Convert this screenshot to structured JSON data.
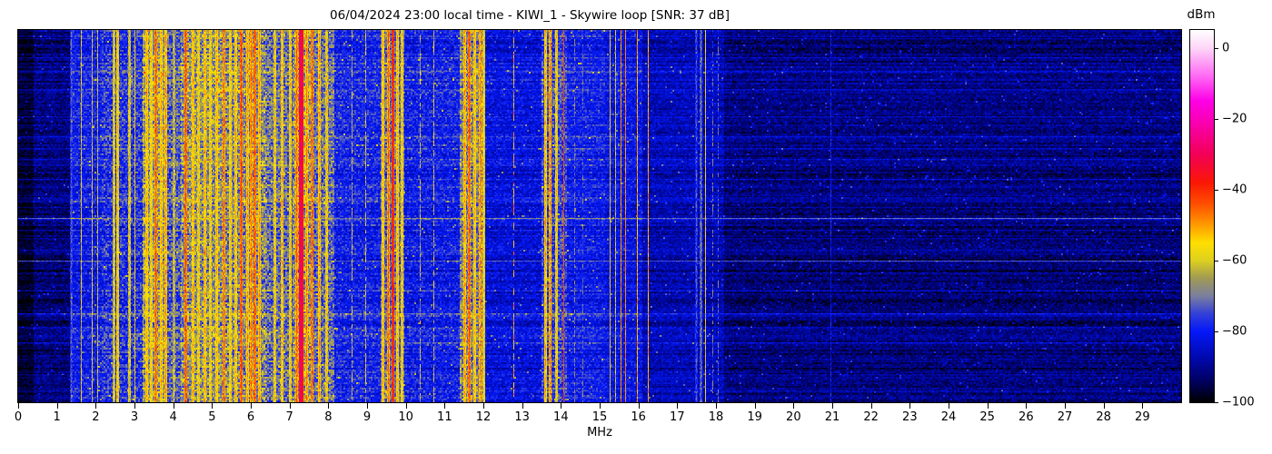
{
  "title": "06/04/2024 23:00 local time - KIWI_1 - Skywire loop [SNR: 37 dB]",
  "chart_data": {
    "type": "heatmap",
    "subtype": "hf-spectrogram-waterfall",
    "xlabel": "MHz",
    "x_range": [
      0,
      30
    ],
    "x_ticks": [
      0,
      1,
      2,
      3,
      4,
      5,
      6,
      7,
      8,
      9,
      10,
      11,
      12,
      13,
      14,
      15,
      16,
      17,
      18,
      19,
      20,
      21,
      22,
      23,
      24,
      25,
      26,
      27,
      28,
      29
    ],
    "y_ticks": [],
    "colorbar": {
      "label": "dBm",
      "vmax": 5,
      "vmin": -100,
      "ticks": [
        0,
        -20,
        -40,
        -60,
        -80,
        -100
      ],
      "tick_labels": [
        "0",
        "−20",
        "−40",
        "−60",
        "−80",
        "−100"
      ],
      "stops": [
        {
          "v": 5,
          "c": "#ffffff"
        },
        {
          "v": 0,
          "c": "#fed7f8"
        },
        {
          "v": -8,
          "c": "#ff6af4"
        },
        {
          "v": -15,
          "c": "#fe00e6"
        },
        {
          "v": -22,
          "c": "#f800a8"
        },
        {
          "v": -30,
          "c": "#f30057"
        },
        {
          "v": -38,
          "c": "#fa1705"
        },
        {
          "v": -44,
          "c": "#ff4e00"
        },
        {
          "v": -50,
          "c": "#ff9b00"
        },
        {
          "v": -55,
          "c": "#ffdf00"
        },
        {
          "v": -60,
          "c": "#ddd01e"
        },
        {
          "v": -65,
          "c": "#a09a55"
        },
        {
          "v": -70,
          "c": "#7b7f9e"
        },
        {
          "v": -75,
          "c": "#3340d8"
        },
        {
          "v": -80,
          "c": "#0418f8"
        },
        {
          "v": -88,
          "c": "#0008a8"
        },
        {
          "v": -94,
          "c": "#000060"
        },
        {
          "v": -100,
          "c": "#000000"
        }
      ]
    },
    "bands": [
      [
        0.0,
        0.4,
        -97,
        3
      ],
      [
        0.4,
        1.35,
        -92,
        5
      ],
      [
        1.35,
        2.15,
        -80,
        7
      ],
      [
        2.15,
        3.2,
        -77,
        9
      ],
      [
        3.2,
        3.85,
        -66,
        11
      ],
      [
        3.85,
        4.2,
        -73,
        10
      ],
      [
        4.2,
        5.3,
        -67,
        11
      ],
      [
        5.3,
        6.4,
        -68,
        11
      ],
      [
        6.4,
        7.1,
        -71,
        10
      ],
      [
        7.1,
        7.6,
        -66,
        11
      ],
      [
        7.6,
        8.15,
        -71,
        10
      ],
      [
        8.15,
        9.35,
        -79,
        7
      ],
      [
        9.35,
        9.95,
        -71,
        9
      ],
      [
        9.95,
        11.4,
        -80,
        7
      ],
      [
        11.4,
        12.05,
        -69,
        10
      ],
      [
        12.05,
        13.5,
        -83,
        6
      ],
      [
        13.5,
        14.15,
        -75,
        8
      ],
      [
        14.15,
        15.15,
        -80,
        6
      ],
      [
        15.15,
        16.1,
        -82,
        6
      ],
      [
        16.1,
        18.2,
        -87,
        5
      ],
      [
        18.2,
        30.0,
        -92,
        5
      ]
    ],
    "carriers": [
      [
        1.35,
        -74,
        2,
        0.3
      ],
      [
        1.61,
        -60,
        1,
        0.4
      ],
      [
        1.91,
        -61,
        1,
        0.4
      ],
      [
        2.05,
        -63,
        1,
        0.4
      ],
      [
        2.45,
        -58,
        2,
        0.35
      ],
      [
        2.55,
        -54,
        3,
        0.3
      ],
      [
        2.85,
        -58,
        2,
        0.4
      ],
      [
        3.01,
        -58,
        1,
        0.4
      ],
      [
        3.3,
        -52,
        2,
        0.3
      ],
      [
        3.42,
        -55,
        2,
        0.3
      ],
      [
        3.55,
        -45,
        3,
        0.3
      ],
      [
        3.68,
        -52,
        2,
        0.3
      ],
      [
        3.8,
        -50,
        2,
        0.3
      ],
      [
        4.0,
        -62,
        2,
        0.4
      ],
      [
        4.32,
        -44,
        3,
        0.3
      ],
      [
        4.5,
        -52,
        2,
        0.35
      ],
      [
        4.65,
        -55,
        2,
        0.35
      ],
      [
        4.8,
        -52,
        2,
        0.35
      ],
      [
        4.95,
        -55,
        2,
        0.35
      ],
      [
        5.1,
        -52,
        2,
        0.3
      ],
      [
        5.3,
        -46,
        2,
        0.3
      ],
      [
        5.45,
        -54,
        2,
        0.3
      ],
      [
        5.6,
        -52,
        2,
        0.3
      ],
      [
        5.75,
        -43,
        2,
        0.3
      ],
      [
        5.9,
        -50,
        2,
        0.3
      ],
      [
        6.0,
        -47,
        2,
        0.3
      ],
      [
        6.1,
        -44,
        3,
        0.3
      ],
      [
        6.2,
        -50,
        2,
        0.3
      ],
      [
        6.6,
        -55,
        2,
        0.4
      ],
      [
        6.8,
        -53,
        2,
        0.4
      ],
      [
        7.0,
        -55,
        2,
        0.4
      ],
      [
        7.18,
        -46,
        2,
        0.3
      ],
      [
        7.3,
        -28,
        4,
        0.2
      ],
      [
        7.44,
        -48,
        2,
        0.3
      ],
      [
        7.58,
        -45,
        2,
        0.3
      ],
      [
        7.75,
        -50,
        2,
        0.35
      ],
      [
        7.95,
        -55,
        2,
        0.4
      ],
      [
        8.6,
        -63,
        1,
        0.5
      ],
      [
        8.95,
        -62,
        1,
        0.5
      ],
      [
        9.4,
        -52,
        2,
        0.3
      ],
      [
        9.53,
        -46,
        2,
        0.3
      ],
      [
        9.65,
        -38,
        2,
        0.25
      ],
      [
        9.78,
        -52,
        2,
        0.3
      ],
      [
        9.9,
        -55,
        2,
        0.35
      ],
      [
        10.35,
        -63,
        1,
        0.6
      ],
      [
        10.7,
        -62,
        1,
        0.6
      ],
      [
        11.5,
        -50,
        2,
        0.3
      ],
      [
        11.63,
        -44,
        2,
        0.3
      ],
      [
        11.77,
        -52,
        2,
        0.3
      ],
      [
        11.9,
        -48,
        2,
        0.3
      ],
      [
        12.0,
        -55,
        2,
        0.35
      ],
      [
        12.78,
        -55,
        1,
        0.75
      ],
      [
        13.6,
        -52,
        2,
        0.35
      ],
      [
        13.72,
        -48,
        2,
        0.35
      ],
      [
        13.87,
        -55,
        2,
        0.4
      ],
      [
        14.07,
        -42,
        1,
        0.3
      ],
      [
        14.35,
        -73,
        1,
        0.5
      ],
      [
        14.55,
        -74,
        1,
        0.5
      ],
      [
        15.25,
        -58,
        1,
        0.35
      ],
      [
        15.4,
        -62,
        1,
        0.4
      ],
      [
        15.55,
        -50,
        1,
        0.25
      ],
      [
        15.65,
        -48,
        1,
        0.25
      ],
      [
        15.95,
        -52,
        1,
        0.4
      ],
      [
        16.25,
        -52,
        1,
        0.35
      ],
      [
        17.48,
        -75,
        2,
        0.3
      ],
      [
        17.6,
        -71,
        2,
        0.3
      ],
      [
        17.72,
        -58,
        1,
        0.4
      ],
      [
        17.9,
        -73,
        1,
        0.5
      ],
      [
        18.05,
        -76,
        1,
        0.5
      ],
      [
        20.95,
        -81,
        1,
        0.4
      ]
    ],
    "time_streaks": [
      [
        0.022,
        6
      ],
      [
        0.073,
        7
      ],
      [
        0.11,
        6
      ],
      [
        0.159,
        7
      ],
      [
        0.232,
        8
      ],
      [
        0.285,
        6
      ],
      [
        0.317,
        5
      ],
      [
        0.346,
        7
      ],
      [
        0.4,
        9
      ],
      [
        0.444,
        6
      ],
      [
        0.476,
        5
      ],
      [
        0.505,
        20
      ],
      [
        0.537,
        7
      ],
      [
        0.559,
        6
      ],
      [
        0.59,
        7
      ],
      [
        0.62,
        15
      ],
      [
        0.651,
        7
      ],
      [
        0.7,
        6
      ],
      [
        0.761,
        8
      ],
      [
        0.798,
        6
      ],
      [
        0.84,
        7
      ],
      [
        0.883,
        6
      ],
      [
        0.924,
        5
      ],
      [
        0.968,
        6
      ]
    ]
  }
}
